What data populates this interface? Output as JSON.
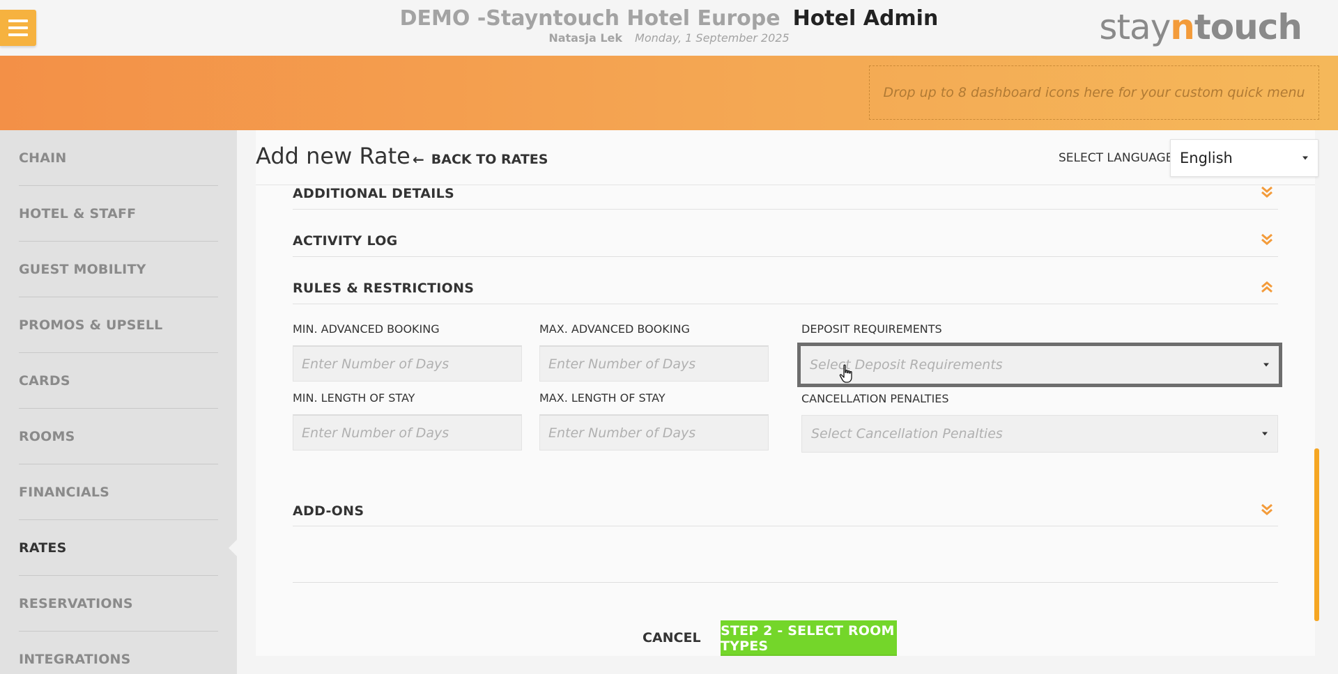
{
  "header": {
    "hotel_name": "DEMO -Stayntouch Hotel Europe",
    "app_name": "Hotel Admin",
    "user_name": "Natasja Lek",
    "date": "Monday, 1 September 2025",
    "logo_prefix": "stay",
    "logo_n": "n",
    "logo_suffix": "touch"
  },
  "quick_menu": {
    "drop_text": "Drop up to 8 dashboard icons here for your custom quick menu"
  },
  "sidebar": {
    "items": [
      {
        "label": "CHAIN"
      },
      {
        "label": "HOTEL & STAFF"
      },
      {
        "label": "GUEST MOBILITY"
      },
      {
        "label": "PROMOS & UPSELL"
      },
      {
        "label": "CARDS"
      },
      {
        "label": "ROOMS"
      },
      {
        "label": "FINANCIALS"
      },
      {
        "label": "RATES"
      },
      {
        "label": "RESERVATIONS"
      },
      {
        "label": "INTEGRATIONS"
      }
    ],
    "active": "RATES"
  },
  "page": {
    "title": "Add new Rate",
    "back_link": "BACK TO RATES",
    "language_label": "SELECT LANGUAGE",
    "language_value": "English"
  },
  "sections": {
    "additional_details": "ADDITIONAL DETAILS",
    "activity_log": "ACTIVITY LOG",
    "rules_restrictions": "RULES & RESTRICTIONS",
    "add_ons": "ADD-ONS"
  },
  "rules": {
    "min_adv_label": "MIN. ADVANCED BOOKING",
    "min_adv_placeholder": "Enter Number of Days",
    "max_adv_label": "MAX. ADVANCED BOOKING",
    "max_adv_placeholder": "Enter Number of Days",
    "deposit_label": "DEPOSIT REQUIREMENTS",
    "deposit_placeholder": "Select Deposit Requirements",
    "min_los_label": "MIN. LENGTH OF STAY",
    "min_los_placeholder": "Enter Number of Days",
    "max_los_label": "MAX. LENGTH OF STAY",
    "max_los_placeholder": "Enter Number of Days",
    "cancel_label": "CANCELLATION PENALTIES",
    "cancel_placeholder": "Select Cancellation Penalties"
  },
  "footer": {
    "cancel": "CANCEL",
    "next": "STEP 2 - SELECT ROOM TYPES"
  },
  "colors": {
    "accent_orange": "#f39b3a",
    "menu_button": "#f6b23f",
    "primary_green": "#74d62a"
  },
  "icons": {
    "menu": "hamburger-icon",
    "back": "arrow-left-icon",
    "expand": "double-chevron-down-icon",
    "collapse": "double-chevron-up-icon",
    "dropdown": "caret-down-icon",
    "cursor": "hand-pointer-icon"
  }
}
